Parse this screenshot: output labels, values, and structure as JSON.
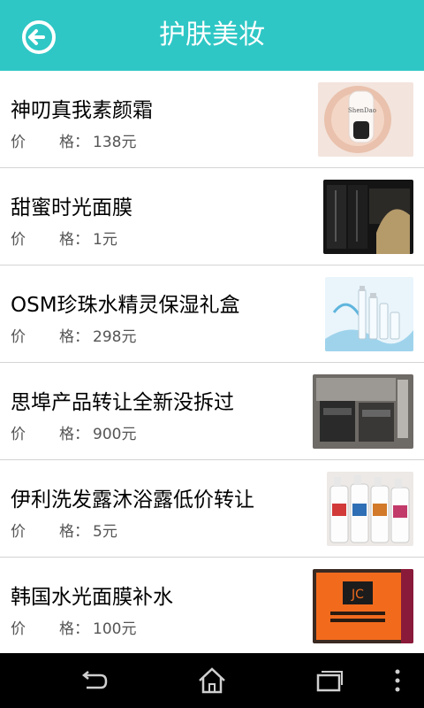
{
  "header": {
    "title": "护肤美妆",
    "accent_color": "#2ec7c5",
    "back_icon": "back-arrow-circle-icon"
  },
  "items": [
    {
      "title": "神叨真我素颜霜",
      "price_label": "价",
      "price_label2": "格：",
      "price": "138元",
      "thumb": "cream-product"
    },
    {
      "title": "甜蜜时光面膜",
      "price_label": "价",
      "price_label2": "格：",
      "price": "1元",
      "thumb": "face-mask-box"
    },
    {
      "title": "OSM珍珠水精灵保湿礼盒",
      "price_label": "价",
      "price_label2": "格：",
      "price": "298元",
      "thumb": "water-bottles"
    },
    {
      "title": "思埠产品转让全新没拆过",
      "price_label": "价",
      "price_label2": "格：",
      "price": "900元",
      "thumb": "boxed-products"
    },
    {
      "title": "伊利洗发露沐浴露低价转让",
      "price_label": "价",
      "price_label2": "格：",
      "price": "5元",
      "thumb": "shampoo-bottles"
    },
    {
      "title": "韩国水光面膜补水",
      "price_label": "价",
      "price_label2": "格：",
      "price": "100元",
      "thumb": "orange-mask-pack"
    }
  ],
  "navbar": {
    "back": "nav-back-icon",
    "home": "nav-home-icon",
    "recents": "nav-recents-icon",
    "menu": "nav-menu-icon"
  }
}
